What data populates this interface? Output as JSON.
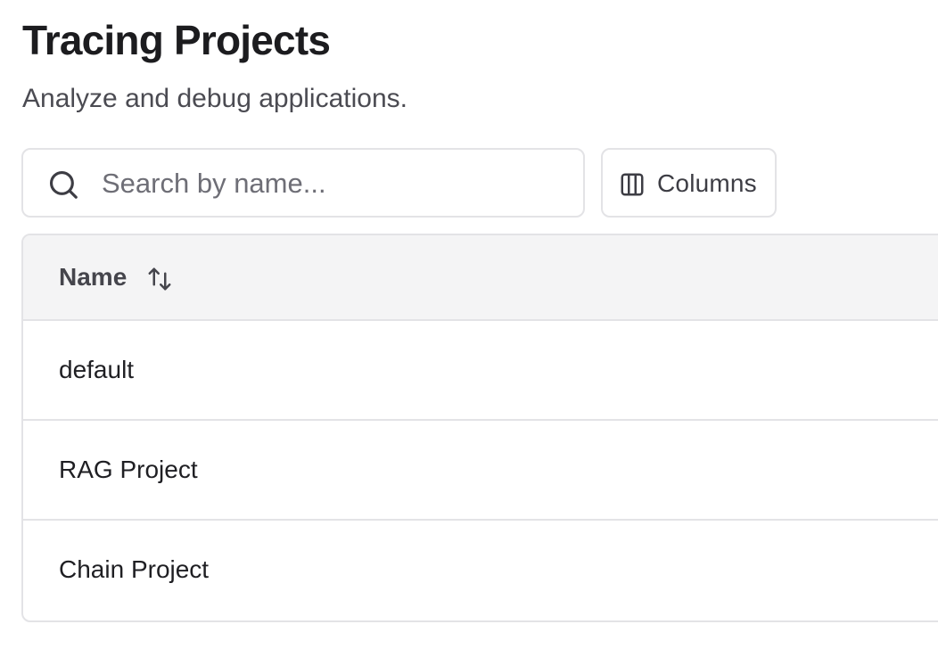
{
  "header": {
    "title": "Tracing Projects",
    "subtitle": "Analyze and debug applications."
  },
  "toolbar": {
    "search_placeholder": "Search by name...",
    "search_icon": "search-icon",
    "columns_label": "Columns",
    "columns_icon": "columns-icon"
  },
  "table": {
    "columns": [
      {
        "label": "Name",
        "sort_icon": "sort-icon"
      }
    ],
    "rows": [
      {
        "name": "default"
      },
      {
        "name": "RAG Project"
      },
      {
        "name": "Chain Project"
      }
    ]
  }
}
